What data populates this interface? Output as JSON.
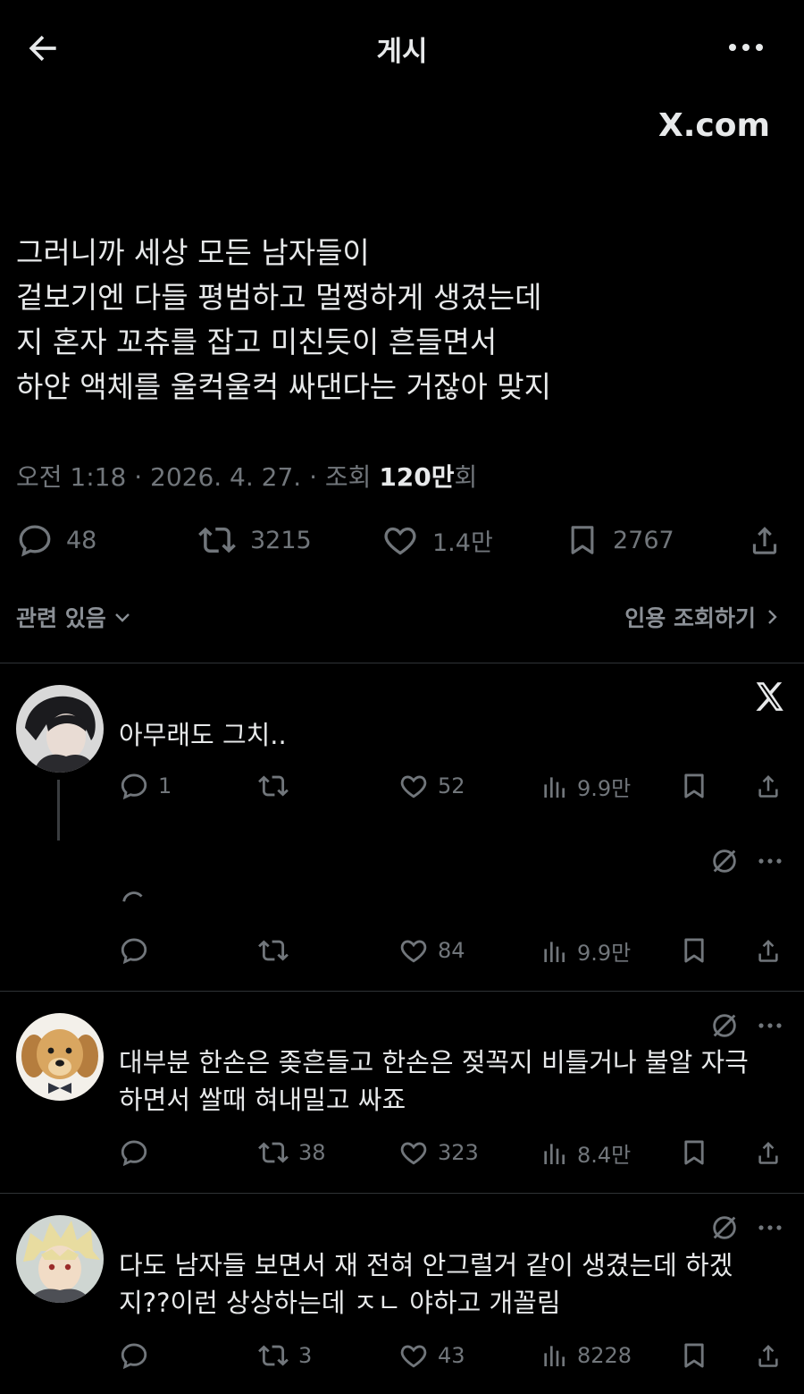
{
  "header": {
    "title": "게시"
  },
  "watermark": "X.com",
  "post": {
    "body_lines": [
      "그러니까 세상 모든 남자들이",
      "겉보기엔 다들 평범하고 멀쩡하게 생겼는데",
      "지 혼자 꼬츄를 잡고 미친듯이 흔들면서",
      "하얀 액체를 울컥울컥 싸댄다는 거잖아 맞지"
    ],
    "meta_prefix": "오전 1:18 · 2026. 4. 27. · 조회 ",
    "views": "120만",
    "views_suffix": "회",
    "actions": {
      "replies": "48",
      "reposts": "3215",
      "likes": "1.4만",
      "bookmarks": "2767"
    },
    "related_label": "관련 있음",
    "quotes_label": "인용 조회하기"
  },
  "replies": [
    {
      "text_lines": [
        "아무래도 그치.."
      ],
      "replies": "1",
      "reposts": "",
      "likes": "52",
      "views": "9.9만"
    },
    {
      "text_lines": [],
      "replies": "",
      "reposts": "",
      "likes": "84",
      "views": "9.9만"
    },
    {
      "text_lines": [
        "대부분 한손은 좆흔들고 한손은 젖꼭지 비틀거나 불알 자극",
        "하면서 쌀때 혀내밀고 싸죠"
      ],
      "replies": "",
      "reposts": "38",
      "likes": "323",
      "views": "8.4만"
    },
    {
      "text_lines": [
        "다도 남자들 보면서 재 전혀 안그럴거 같이 생겼는데 하겠",
        "지??이런 상상하는데 ㅈㄴ 야하고 개꼴림"
      ],
      "replies": "",
      "reposts": "3",
      "likes": "43",
      "views": "8228"
    }
  ],
  "colors": {
    "background": "#000000",
    "text": "#e7e9ea",
    "muted": "#71767b",
    "divider": "#2f3336"
  }
}
